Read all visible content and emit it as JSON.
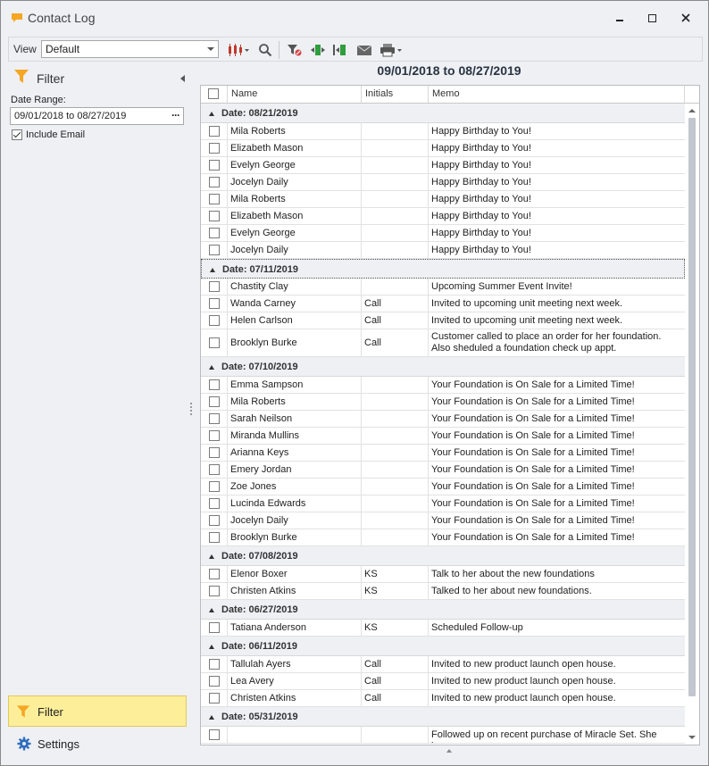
{
  "window": {
    "title": "Contact Log",
    "min_label": "",
    "max_label": "",
    "close_label": "✕"
  },
  "toolbar": {
    "view_label": "View",
    "view_value": "Default"
  },
  "filter_panel": {
    "title": "Filter",
    "date_range_label": "Date Range:",
    "date_range_value": "09/01/2018 to 08/27/2019",
    "date_range_button": "···",
    "include_email_label": "Include Email",
    "include_email_checked": true
  },
  "nav": {
    "filter_label": "Filter",
    "settings_label": "Settings"
  },
  "main": {
    "range_title": "09/01/2018 to 08/27/2019",
    "columns": [
      "",
      "Name",
      "Initials",
      "Memo"
    ],
    "groups": [
      {
        "label": "Date: 08/21/2019",
        "rows": [
          {
            "name": "Mila Roberts",
            "initials": "",
            "memo": "Happy Birthday to You!"
          },
          {
            "name": "Elizabeth Mason",
            "initials": "",
            "memo": "Happy Birthday to You!"
          },
          {
            "name": "Evelyn George",
            "initials": "",
            "memo": "Happy Birthday to You!"
          },
          {
            "name": "Jocelyn Daily",
            "initials": "",
            "memo": "Happy Birthday to You!"
          },
          {
            "name": "Mila Roberts",
            "initials": "",
            "memo": "Happy Birthday to You!"
          },
          {
            "name": "Elizabeth Mason",
            "initials": "",
            "memo": "Happy Birthday to You!"
          },
          {
            "name": "Evelyn George",
            "initials": "",
            "memo": "Happy Birthday to You!"
          },
          {
            "name": "Jocelyn Daily",
            "initials": "",
            "memo": "Happy Birthday to You!"
          }
        ]
      },
      {
        "label": "Date: 07/11/2019",
        "focused": true,
        "rows": [
          {
            "name": "Chastity Clay",
            "initials": "",
            "memo": "Upcoming Summer Event Invite!"
          },
          {
            "name": "Wanda Carney",
            "initials": "Call",
            "memo": "Invited to upcoming unit meeting next week."
          },
          {
            "name": "Helen Carlson",
            "initials": "Call",
            "memo": "Invited to upcoming unit meeting next week."
          },
          {
            "name": "Brooklyn Burke",
            "initials": "Call",
            "memo": "Customer called to place an order for her foundation. Also sheduled a foundation check up appt.",
            "tall": true
          }
        ]
      },
      {
        "label": "Date: 07/10/2019",
        "rows": [
          {
            "name": "Emma Sampson",
            "initials": "",
            "memo": "Your Foundation is On Sale for a Limited Time!"
          },
          {
            "name": "Mila Roberts",
            "initials": "",
            "memo": "Your Foundation is On Sale for a Limited Time!"
          },
          {
            "name": "Sarah Neilson",
            "initials": "",
            "memo": "Your Foundation is On Sale for a Limited Time!"
          },
          {
            "name": "Miranda Mullins",
            "initials": "",
            "memo": "Your Foundation is On Sale for a Limited Time!"
          },
          {
            "name": "Arianna Keys",
            "initials": "",
            "memo": "Your Foundation is On Sale for a Limited Time!"
          },
          {
            "name": "Emery Jordan",
            "initials": "",
            "memo": "Your Foundation is On Sale for a Limited Time!"
          },
          {
            "name": "Zoe Jones",
            "initials": "",
            "memo": "Your Foundation is On Sale for a Limited Time!"
          },
          {
            "name": "Lucinda Edwards",
            "initials": "",
            "memo": "Your Foundation is On Sale for a Limited Time!"
          },
          {
            "name": "Jocelyn Daily",
            "initials": "",
            "memo": "Your Foundation is On Sale for a Limited Time!"
          },
          {
            "name": "Brooklyn Burke",
            "initials": "",
            "memo": "Your Foundation is On Sale for a Limited Time!"
          }
        ]
      },
      {
        "label": "Date: 07/08/2019",
        "rows": [
          {
            "name": "Elenor Boxer",
            "initials": "KS",
            "memo": "Talk to her about the new foundations"
          },
          {
            "name": "Christen Atkins",
            "initials": "KS",
            "memo": "Talked to her about new foundations."
          }
        ]
      },
      {
        "label": "Date: 06/27/2019",
        "rows": [
          {
            "name": "Tatiana Anderson",
            "initials": "KS",
            "memo": "Scheduled Follow-up"
          }
        ]
      },
      {
        "label": "Date: 06/11/2019",
        "rows": [
          {
            "name": "Tallulah Ayers",
            "initials": "Call",
            "memo": "Invited to new product launch open house."
          },
          {
            "name": "Lea Avery",
            "initials": "Call",
            "memo": "Invited to new product launch open house."
          },
          {
            "name": "Christen Atkins",
            "initials": "Call",
            "memo": "Invited to new product launch open house."
          }
        ]
      },
      {
        "label": "Date: 05/31/2019",
        "rows": [
          {
            "name": "",
            "initials": "",
            "memo": "Followed up on recent purchase of Miracle Set. She loves"
          }
        ]
      }
    ]
  },
  "icons": {
    "app": "chat-bubble-icon",
    "accent_orange": "#f5a623",
    "accent_green": "#2e9e3e",
    "nav_selected_bg": "#fdee9a"
  }
}
